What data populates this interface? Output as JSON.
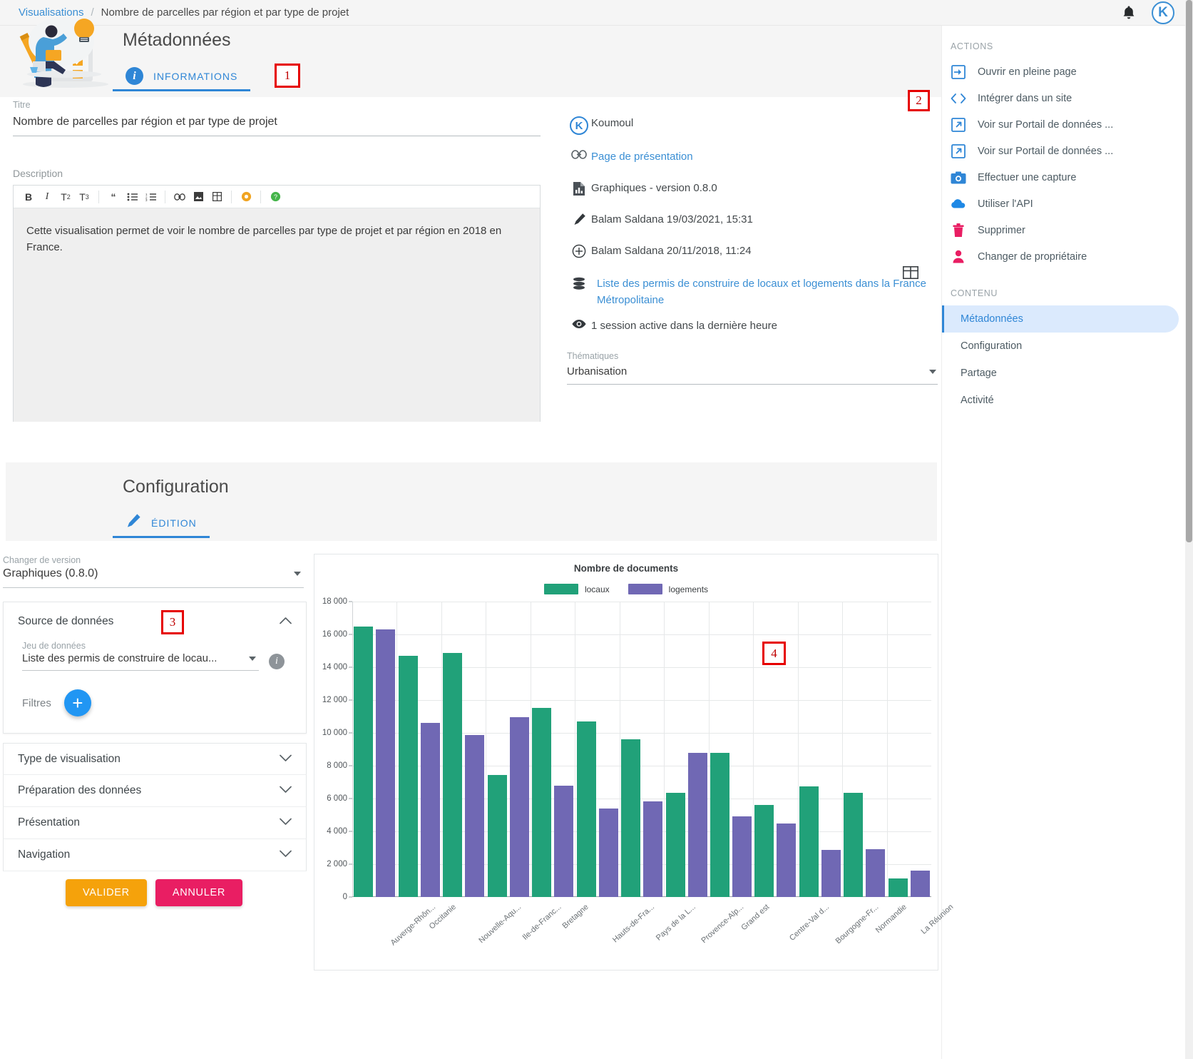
{
  "topbar": {
    "breadcrumb_root": "Visualisations",
    "breadcrumb_sep": "/",
    "breadcrumb_current": "Nombre de parcelles par région et par type de projet",
    "bell_icon": "bell-icon",
    "avatar_letter": "K"
  },
  "metadata_card": {
    "title": "Métadonnées",
    "tab_label": "INFORMATIONS",
    "tab_icon": "info-icon"
  },
  "form": {
    "titre_label": "Titre",
    "titre_value": "Nombre de parcelles par région et par type de projet",
    "description_label": "Description",
    "description_text": "Cette visualisation permet de voir le nombre de parcelles par type de projet et par région en 2018 en France.",
    "toolbar": [
      {
        "name": "bold-icon",
        "glyph": "B"
      },
      {
        "name": "italic-icon",
        "glyph": "I"
      },
      {
        "name": "heading2-icon",
        "glyph": "T₂"
      },
      {
        "name": "heading3-icon",
        "glyph": "T₃"
      },
      {
        "name": "quote-icon",
        "glyph": "“"
      },
      {
        "name": "bullet-list-icon",
        "glyph": "☰"
      },
      {
        "name": "numbered-list-icon",
        "glyph": "≡"
      },
      {
        "name": "link-icon",
        "glyph": "⚭"
      },
      {
        "name": "image-icon",
        "glyph": "▣"
      },
      {
        "name": "table-icon",
        "glyph": "⊞"
      },
      {
        "name": "preview-icon",
        "glyph": "●"
      },
      {
        "name": "help-icon",
        "glyph": "?"
      }
    ]
  },
  "meta_info": {
    "rows": [
      {
        "icon": "koumoul-logo-icon",
        "text": "Koumoul",
        "link": false
      },
      {
        "icon": "link-icon",
        "text": "Page de présentation",
        "link": true
      },
      {
        "icon": "file-chart-icon",
        "text": "Graphiques - version 0.8.0",
        "link": false
      },
      {
        "icon": "pencil-icon",
        "text": "Balam Saldana 19/03/2021, 15:31",
        "link": false
      },
      {
        "icon": "plus-circle-icon",
        "text": "Balam Saldana 20/11/2018, 11:24",
        "link": false
      },
      {
        "icon": "database-icon",
        "text": "Liste des permis de construire de locaux et logements dans la France Métropolitaine",
        "link": true
      },
      {
        "icon": "eye-icon",
        "text": "1 session active dans la dernière heure",
        "link": false
      }
    ],
    "thematiques_label": "Thématiques",
    "thematiques_value": "Urbanisation",
    "table_icon": "table-icon"
  },
  "sidebar": {
    "actions_title": "ACTIONS",
    "actions": [
      {
        "label": "Ouvrir en pleine page",
        "icon": "open-fullpage-icon",
        "color": "#2f86d6"
      },
      {
        "label": "Intégrer dans un site",
        "icon": "code-embed-icon",
        "color": "#2f86d6"
      },
      {
        "label": "Voir sur Portail de données ...",
        "icon": "external-link-icon",
        "color": "#2f86d6"
      },
      {
        "label": "Voir sur Portail de données ...",
        "icon": "external-link-icon",
        "color": "#2f86d6"
      },
      {
        "label": "Effectuer une capture",
        "icon": "camera-icon",
        "color": "#2f86d6"
      },
      {
        "label": "Utiliser l'API",
        "icon": "cloud-icon",
        "color": "#2f86d6"
      },
      {
        "label": "Supprimer",
        "icon": "trash-icon",
        "color": "#e91e63"
      },
      {
        "label": "Changer de propriétaire",
        "icon": "person-icon",
        "color": "#e91e63"
      }
    ],
    "contenu_title": "CONTENU",
    "contenu": [
      {
        "label": "Métadonnées",
        "active": true
      },
      {
        "label": "Configuration",
        "active": false
      },
      {
        "label": "Partage",
        "active": false
      },
      {
        "label": "Activité",
        "active": false
      }
    ]
  },
  "config_card": {
    "title": "Configuration",
    "tab_label": "ÉDITION",
    "tab_icon": "pencil-icon"
  },
  "config": {
    "version_label": "Changer de version",
    "version_value": "Graphiques (0.8.0)",
    "source_title": "Source de données",
    "jeu_label": "Jeu de données",
    "jeu_value": "Liste des permis de construire de locau...",
    "filtres_label": "Filtres",
    "add_filter_icon": "plus-icon",
    "accordions": [
      "Type de visualisation",
      "Préparation des données",
      "Présentation",
      "Navigation"
    ],
    "validate_label": "VALIDER",
    "cancel_label": "ANNULER",
    "validate_color": "#f5a20b",
    "cancel_color": "#e91e63"
  },
  "annotations": [
    {
      "number": "1"
    },
    {
      "number": "2"
    },
    {
      "number": "3"
    },
    {
      "number": "4"
    }
  ],
  "chart_data": {
    "type": "bar",
    "title": "Nombre de documents",
    "xlabel": "",
    "ylabel": "",
    "ylim": [
      0,
      18000
    ],
    "yticks": [
      0,
      2000,
      4000,
      6000,
      8000,
      10000,
      12000,
      14000,
      16000,
      18000
    ],
    "ytick_labels": [
      "0",
      "2 000",
      "4 000",
      "6 000",
      "8 000",
      "10 000",
      "12 000",
      "14 000",
      "16 000",
      "18 000"
    ],
    "grid": true,
    "legend_position": "top",
    "categories": [
      "Auverge-Rhôn...",
      "Occitanie",
      "Nouvelle-Aqu...",
      "Ile-de-Franc...",
      "Bretagne",
      "Hauts-de-Fra...",
      "Pays de la L...",
      "Provence-Alp...",
      "Grand est",
      "Centre-Val d...",
      "Bourgogne-Fr...",
      "Normandie",
      "La Réunion"
    ],
    "series": [
      {
        "name": "locaux",
        "color": "#21a179",
        "values": [
          16480,
          14700,
          14870,
          7420,
          11540,
          10680,
          9620,
          6350,
          8800,
          5600,
          6750,
          6370,
          1150
        ]
      },
      {
        "name": "logements",
        "color": "#7068b4",
        "values": [
          16320,
          10600,
          9850,
          10950,
          6790,
          5400,
          5840,
          8800,
          4900,
          4480,
          2850,
          2900,
          1600
        ]
      }
    ]
  }
}
